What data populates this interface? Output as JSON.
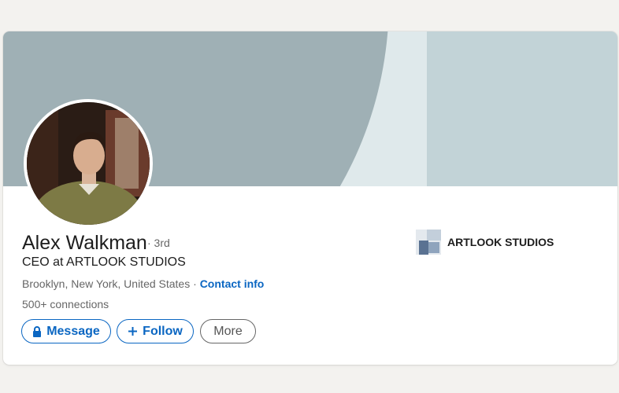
{
  "profile": {
    "name": "Alex Walkman",
    "degree": "· 3rd",
    "headline": "CEO at ARTLOOK STUDIOS",
    "location": "Brooklyn, New York, United States",
    "separator": " · ",
    "contact_info_label": "Contact info",
    "connections": "500+ connections"
  },
  "actions": {
    "message_label": "Message",
    "follow_label": "Follow",
    "more_label": "More"
  },
  "company": {
    "name": "ARTLOOK STUDIOS"
  },
  "colors": {
    "accent": "#0a66c2",
    "banner_dark": "#9fb0b5",
    "banner_light": "#c2d3d7",
    "banner_mid": "#dfe9eb"
  },
  "icons": {
    "message": "lock-icon",
    "follow": "plus-icon"
  }
}
